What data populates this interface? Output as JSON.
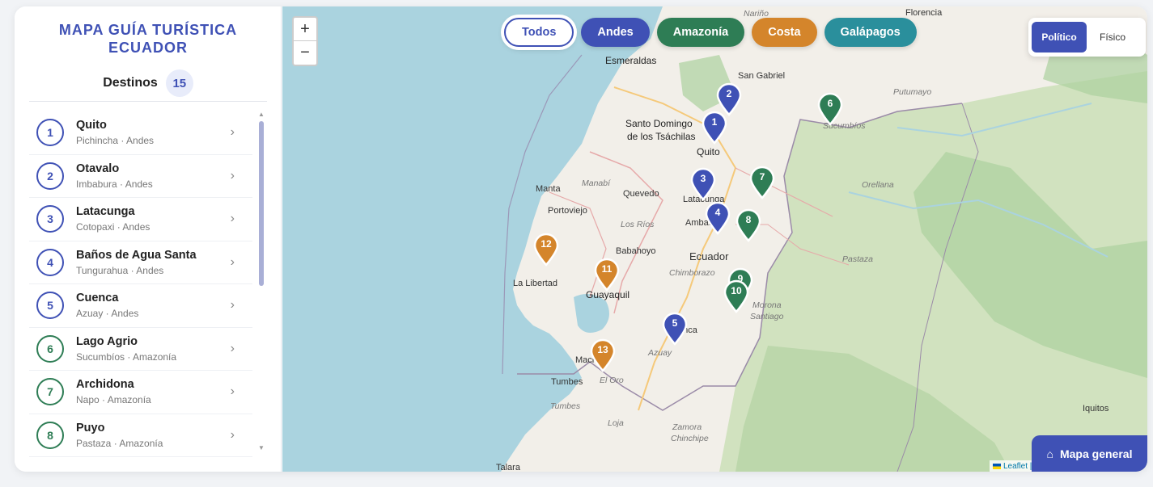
{
  "sidebar": {
    "title_line1": "MAPA GUÍA TURÍSTICA",
    "title_line2": "ECUADOR",
    "destinos_label": "Destinos",
    "destinos_count": "15"
  },
  "colors": {
    "andes": "#3f51b5",
    "amazonia": "#2e7d55",
    "costa": "#d4852b",
    "galapagos": "#2a8f9c"
  },
  "destinations": [
    {
      "num": "1",
      "name": "Quito",
      "sub": "Pichincha · Andes",
      "region": "andes"
    },
    {
      "num": "2",
      "name": "Otavalo",
      "sub": "Imbabura · Andes",
      "region": "andes"
    },
    {
      "num": "3",
      "name": "Latacunga",
      "sub": "Cotopaxi · Andes",
      "region": "andes"
    },
    {
      "num": "4",
      "name": "Baños de Agua Santa",
      "sub": "Tungurahua · Andes",
      "region": "andes"
    },
    {
      "num": "5",
      "name": "Cuenca",
      "sub": "Azuay · Andes",
      "region": "andes"
    },
    {
      "num": "6",
      "name": "Lago Agrio",
      "sub": "Sucumbíos · Amazonía",
      "region": "amazonia"
    },
    {
      "num": "7",
      "name": "Archidona",
      "sub": "Napo · Amazonía",
      "region": "amazonia"
    },
    {
      "num": "8",
      "name": "Puyo",
      "sub": "Pastaza · Amazonía",
      "region": "amazonia"
    }
  ],
  "chevron": "›",
  "filters": [
    {
      "label": "Todos",
      "key": "todos"
    },
    {
      "label": "Andes",
      "key": "andes"
    },
    {
      "label": "Amazonía",
      "key": "amazonia"
    },
    {
      "label": "Costa",
      "key": "costa"
    },
    {
      "label": "Galápagos",
      "key": "galapagos"
    }
  ],
  "map_type": {
    "active": "Político",
    "other": "Físico"
  },
  "zoom": {
    "in": "+",
    "out": "−"
  },
  "general_button": "Mapa general",
  "general_icon": "⌂",
  "attribution": "Leaflet |",
  "map_labels": {
    "florencia": "Florencia",
    "narino": "Nariño",
    "esmeraldas": "Esmeraldas",
    "san_gabriel": "San Gabriel",
    "putumayo": "Putumayo",
    "sucumbios": "Sucumbíos",
    "santo_domingo1": "Santo Domingo",
    "santo_domingo2": "de los Tsáchilas",
    "quito": "Quito",
    "orellana": "Orellana",
    "manta": "Manta",
    "manabi": "Manabí",
    "quevedo": "Quevedo",
    "portoviejo": "Portoviejo",
    "los_rios": "Los Ríos",
    "babahoyo": "Babahoyo",
    "ecuador": "Ecuador",
    "pastaza": "Pastaza",
    "chimborazo": "Chimborazo",
    "la_libertad": "La Libertad",
    "guayaquil": "Guayaquil",
    "morona1": "Morona",
    "morona2": "Santiago",
    "azuay": "Azuay",
    "tumbes": "Tumbes",
    "el_oro": "El Oro",
    "tumbes_r": "Tumbes",
    "loja": "Loja",
    "zamora1": "Zamora",
    "zamora2": "Chinchipe",
    "iquitos": "Iquitos",
    "talara": "Talara",
    "latacunga": "Latacunga",
    "ambato": "Ambato",
    "cuenca": "Cuenca",
    "machala": "Machala"
  },
  "markers": [
    {
      "num": "1",
      "region": "andes"
    },
    {
      "num": "2",
      "region": "andes"
    },
    {
      "num": "3",
      "region": "andes"
    },
    {
      "num": "4",
      "region": "andes"
    },
    {
      "num": "5",
      "region": "andes"
    },
    {
      "num": "6",
      "region": "amazonia"
    },
    {
      "num": "7",
      "region": "amazonia"
    },
    {
      "num": "8",
      "region": "amazonia"
    },
    {
      "num": "9",
      "region": "amazonia"
    },
    {
      "num": "10",
      "region": "amazonia"
    },
    {
      "num": "11",
      "region": "costa"
    },
    {
      "num": "12",
      "region": "costa"
    },
    {
      "num": "13",
      "region": "costa"
    }
  ]
}
